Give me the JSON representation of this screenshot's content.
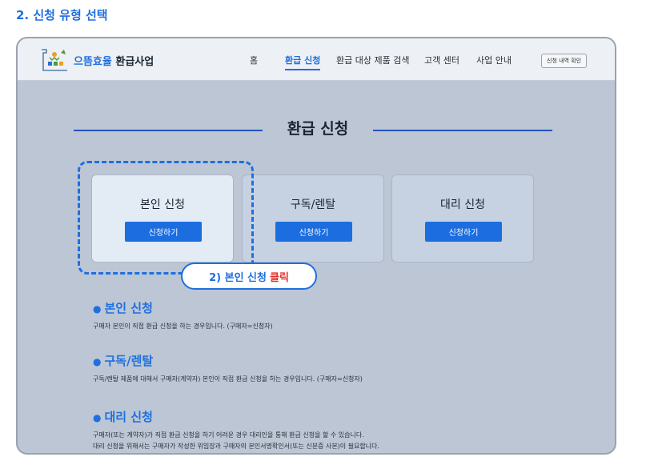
{
  "step_heading": "2. 신청 유형 선택",
  "header": {
    "logo_prefix": "으뜸효율",
    "logo_suffix": " 환급사업",
    "nav": [
      {
        "label": "홈"
      },
      {
        "label": "환급 신청"
      },
      {
        "label": "환급 대상 제품 검색"
      },
      {
        "label": "고객 센터"
      },
      {
        "label": "사업 안내"
      }
    ],
    "check_button": "신청 내역 확인"
  },
  "page_title": "환급 신청",
  "cards": [
    {
      "title": "본인 신청",
      "button": "신청하기"
    },
    {
      "title": "구독/렌탈",
      "button": "신청하기"
    },
    {
      "title": "대리 신청",
      "button": "신청하기"
    }
  ],
  "callout": {
    "text": "2) 본인 신청",
    "emphasis": "클릭"
  },
  "sections": [
    {
      "title": "본인 신청",
      "desc": [
        "구매자 본인이 직접 환급 신청을 하는 경우입니다. (구매자=신청자)"
      ]
    },
    {
      "title": "구독/렌탈",
      "desc": [
        "구독/렌탈 제품에 대해서 구매자(계약자) 본인이 직접 환급 신청을 하는 경우입니다. (구매자=신청자)"
      ]
    },
    {
      "title": "대리 신청",
      "desc": [
        "구매자(또는 계약자)가 직접 환급 신청을 하기 어려운 경우 대리인을 통해 환급 신청을 할 수 있습니다.",
        "대리 신청을 위해서는 구매자가 작성한 위임장과 구매자의 본인서명확인서(또는 신분증 사본)이 필요합니다."
      ]
    }
  ],
  "colors": {
    "accent": "#1e6fe0",
    "highlight_red": "#e5302a",
    "navy_line": "#2354b8"
  }
}
